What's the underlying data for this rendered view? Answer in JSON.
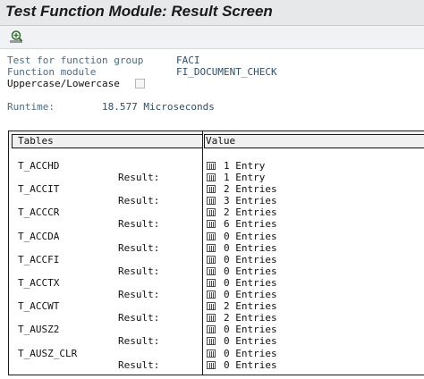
{
  "window": {
    "title": "Test Function Module: Result Screen"
  },
  "toolbar": {
    "buttons": [
      {
        "icon": "zoom-in-icon"
      }
    ]
  },
  "header_fields": {
    "function_group_label": "Test for function group",
    "function_group_value": "FACI",
    "function_module_label": "Function module",
    "function_module_value": "FI_DOCUMENT_CHECK",
    "case_label": "Uppercase/Lowercase",
    "case_checked": false,
    "runtime_label": "Runtime:",
    "runtime_value": "18.577 Microseconds"
  },
  "results_table": {
    "col_tables": "Tables",
    "col_value": "Value",
    "result_label": "Result:",
    "entries": [
      {
        "name": "T_ACCHD",
        "value": "1 Entry",
        "result": "1 Entry"
      },
      {
        "name": "T_ACCIT",
        "value": "2 Entries",
        "result": "3 Entries"
      },
      {
        "name": "T_ACCCR",
        "value": "2 Entries",
        "result": "6 Entries"
      },
      {
        "name": "T_ACCDA",
        "value": "0 Entries",
        "result": "0 Entries"
      },
      {
        "name": "T_ACCFI",
        "value": "0 Entries",
        "result": "0 Entries"
      },
      {
        "name": "T_ACCTX",
        "value": "0 Entries",
        "result": "0 Entries"
      },
      {
        "name": "T_ACCWT",
        "value": "2 Entries",
        "result": "2 Entries"
      },
      {
        "name": "T_AUSZ2",
        "value": "0 Entries",
        "result": "0 Entries"
      },
      {
        "name": "T_AUSZ_CLR",
        "value": "0 Entries",
        "result": "0 Entries"
      }
    ]
  },
  "colors": {
    "title_bar": "#e6e8ea",
    "label_blue": "#4a6b86",
    "value_blue": "#2c4f6e"
  }
}
